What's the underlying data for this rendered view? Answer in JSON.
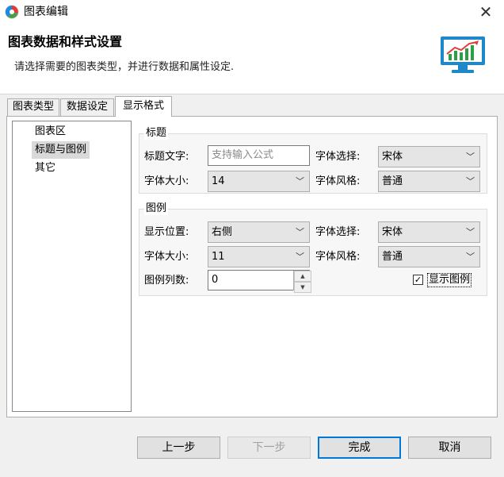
{
  "window": {
    "title": "图表编辑"
  },
  "header": {
    "title": "图表数据和样式设置",
    "subtitle": "请选择需要的图表类型，并进行数据和属性设定."
  },
  "tabs": [
    {
      "label": "图表类型",
      "active": false
    },
    {
      "label": "数据设定",
      "active": false
    },
    {
      "label": "显示格式",
      "active": true
    }
  ],
  "tree": [
    {
      "label": "图表区",
      "selected": false
    },
    {
      "label": "标题与图例",
      "selected": true
    },
    {
      "label": "其它",
      "selected": false
    }
  ],
  "title_group": {
    "label": "标题",
    "text_label": "标题文字:",
    "text_placeholder": "支持输入公式",
    "font_label": "字体选择:",
    "font_value": "宋体",
    "size_label": "字体大小:",
    "size_value": "14",
    "style_label": "字体风格:",
    "style_value": "普通"
  },
  "legend_group": {
    "label": "图例",
    "position_label": "显示位置:",
    "position_value": "右侧",
    "font_label": "字体选择:",
    "font_value": "宋体",
    "size_label": "字体大小:",
    "size_value": "11",
    "style_label": "字体风格:",
    "style_value": "普通",
    "columns_label": "图例列数:",
    "columns_value": "0",
    "show_legend_label": "显示图例",
    "show_legend_checked": true
  },
  "buttons": {
    "prev": "上一步",
    "next": "下一步",
    "finish": "完成",
    "cancel": "取消"
  },
  "icons": {
    "app": "chart-edit-app-icon",
    "close": "close-icon",
    "header": "monitor-chart-icon",
    "dropdown": "chevron-down-icon",
    "spin_up": "spin-up-icon",
    "spin_down": "spin-down-icon"
  },
  "colors": {
    "accent": "#0078d7",
    "monitor_blue": "#1e88c8",
    "chart_green": "#2e9e45",
    "chart_red": "#e53935"
  }
}
